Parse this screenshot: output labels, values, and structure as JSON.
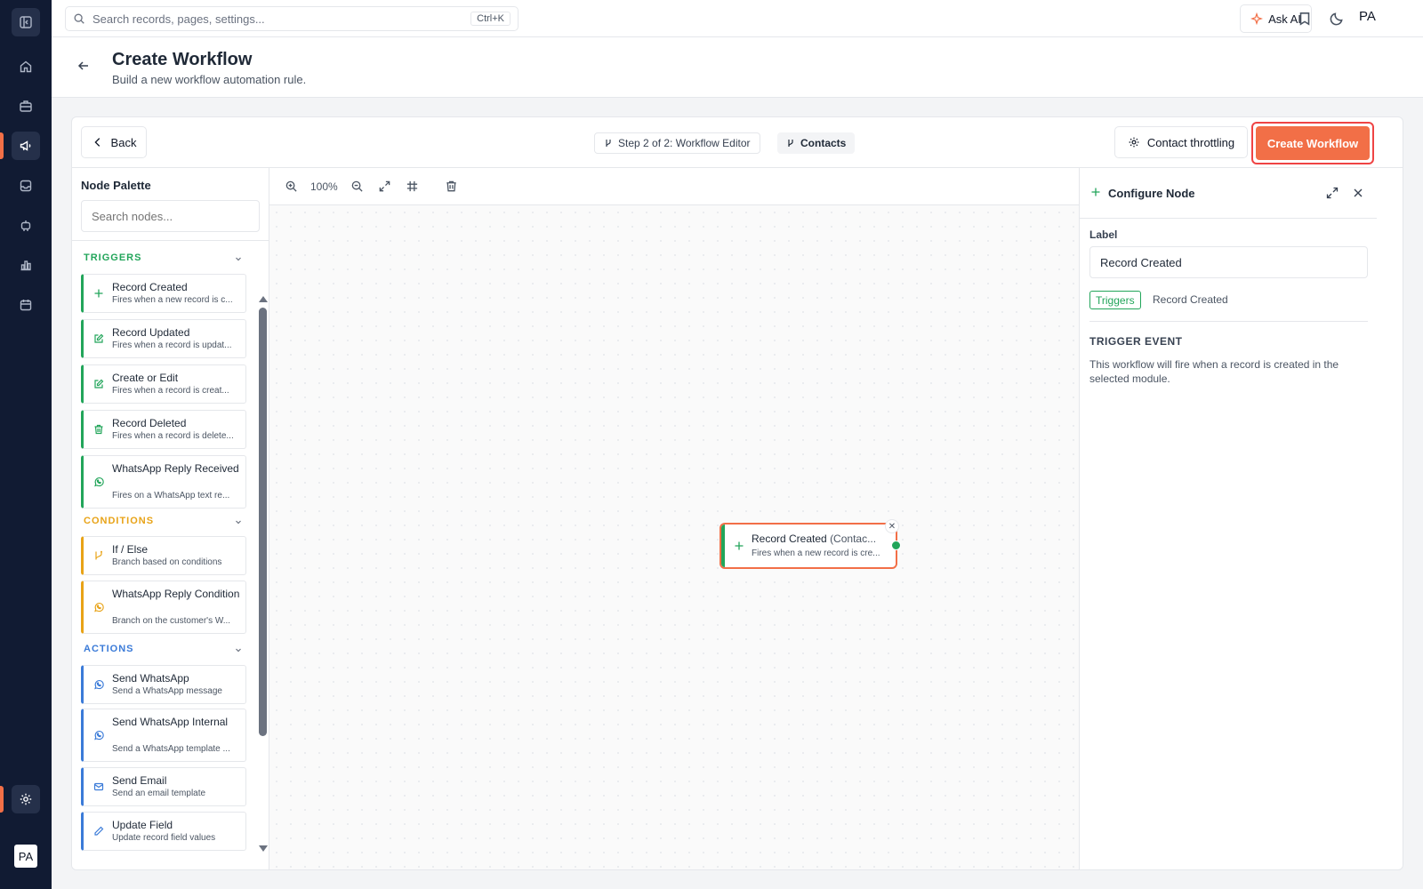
{
  "topbar": {
    "search_placeholder": "Search records, pages, settings...",
    "shortcut": "Ctrl+K",
    "ask_ai": "Ask AI",
    "avatar": "PA"
  },
  "sidebar": {
    "avatar": "PA",
    "icons": [
      "sidebar-toggle-icon",
      "home-icon",
      "briefcase-icon",
      "megaphone-icon",
      "inbox-icon",
      "robot-icon",
      "bar-chart-icon",
      "calendar-icon",
      "settings-icon"
    ],
    "active": "megaphone-icon"
  },
  "page": {
    "title": "Create Workflow",
    "subtitle": "Build a new workflow automation rule."
  },
  "toolbar": {
    "back": "Back",
    "step": "Step 2 of 2: Workflow Editor",
    "module": "Contacts",
    "throttling": "Contact throttling",
    "create": "Create Workflow"
  },
  "palette": {
    "title": "Node Palette",
    "search_placeholder": "Search nodes...",
    "sections": [
      {
        "name": "TRIGGERS",
        "color": "#22a55a",
        "items": [
          {
            "title": "Record Created",
            "desc": "Fires when a new record is c...",
            "icon": "plus-icon"
          },
          {
            "title": "Record Updated",
            "desc": "Fires when a record is updat...",
            "icon": "edit-icon"
          },
          {
            "title": "Create or Edit",
            "desc": "Fires when a record is creat...",
            "icon": "edit-icon"
          },
          {
            "title": "Record Deleted",
            "desc": "Fires when a record is delete...",
            "icon": "trash-icon"
          },
          {
            "title": "WhatsApp Reply Received",
            "desc": "Fires on a WhatsApp text re...",
            "icon": "whatsapp-icon"
          }
        ]
      },
      {
        "name": "CONDITIONS",
        "color": "#e8a317",
        "items": [
          {
            "title": "If / Else",
            "desc": "Branch based on conditions",
            "icon": "branch-icon"
          },
          {
            "title": "WhatsApp Reply Condition",
            "desc": "Branch on the customer's W...",
            "icon": "whatsapp-icon"
          }
        ]
      },
      {
        "name": "ACTIONS",
        "color": "#3b7bd8",
        "items": [
          {
            "title": "Send WhatsApp",
            "desc": "Send a WhatsApp message",
            "icon": "whatsapp-icon"
          },
          {
            "title": "Send WhatsApp Internal",
            "desc": "Send a WhatsApp template ...",
            "icon": "whatsapp-icon"
          },
          {
            "title": "Send Email",
            "desc": "Send an email template",
            "icon": "mail-icon"
          },
          {
            "title": "Update Field",
            "desc": "Update record field values",
            "icon": "pencil-icon"
          }
        ]
      }
    ]
  },
  "canvas": {
    "zoom": "100%",
    "node": {
      "title": "Record Created",
      "module": "(Contac...",
      "desc": "Fires when a new record is cre..."
    }
  },
  "config": {
    "title": "Configure Node",
    "label_heading": "Label",
    "label_value": "Record Created",
    "badge": "Triggers",
    "badge_text": "Record Created",
    "section": "TRIGGER EVENT",
    "description": "This workflow will fire when a record is created in the selected module."
  },
  "colors": {
    "accent": "#f26f47",
    "sidebar_bg": "#111b33",
    "trigger": "#22a55a",
    "condition": "#e8a317",
    "action": "#3b7bd8",
    "highlight": "#ef4444"
  }
}
